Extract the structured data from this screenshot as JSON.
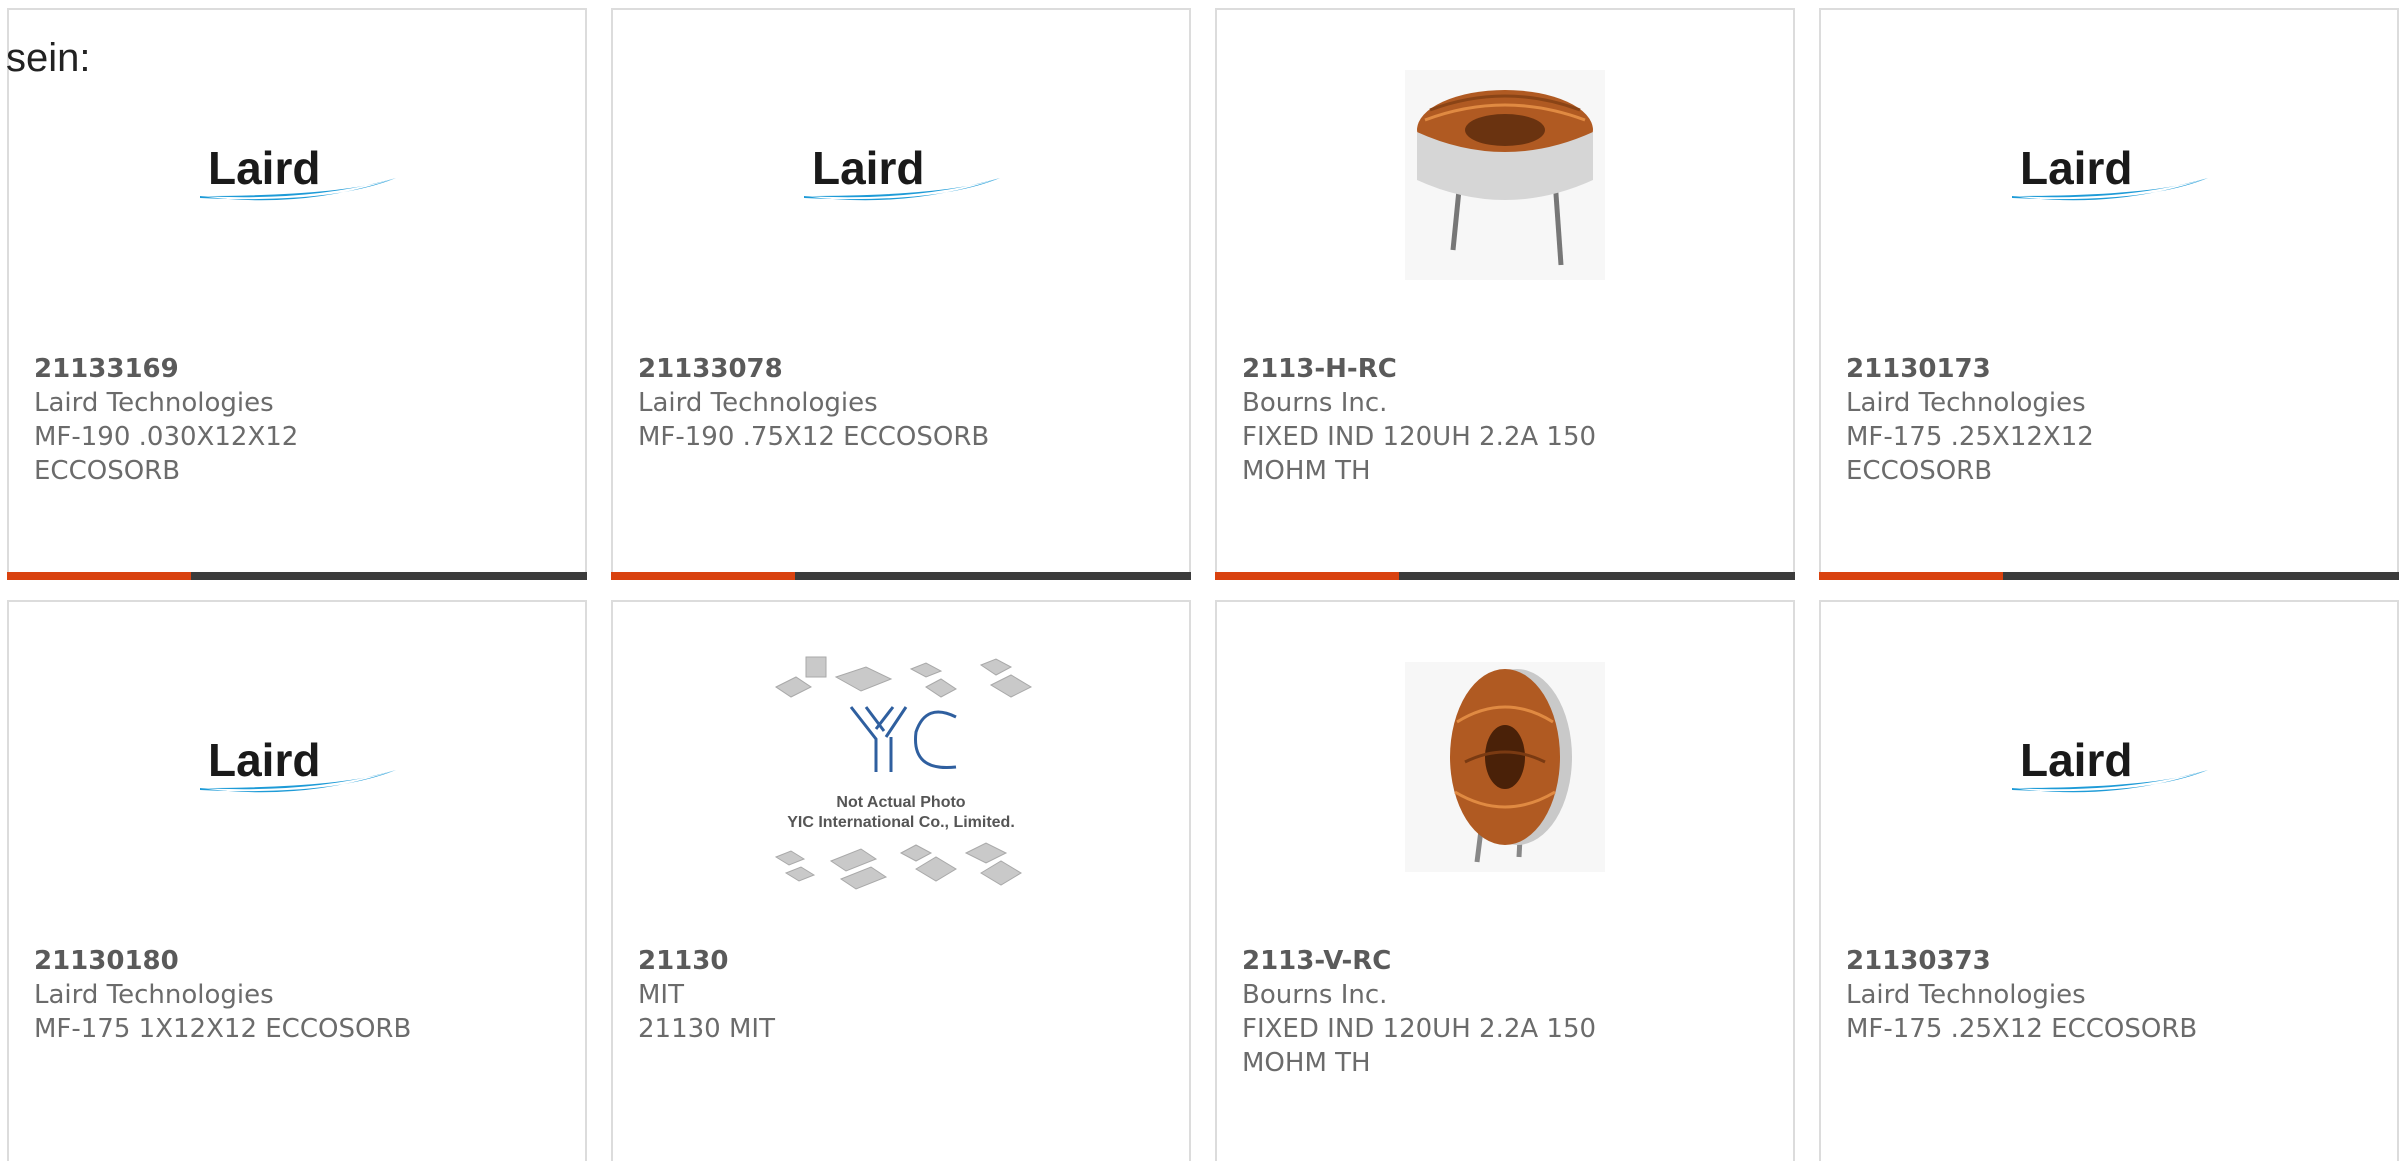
{
  "intro_text": "sein:",
  "colors": {
    "accent_bar": "#d9420f",
    "dark_bar": "#3b3b3b",
    "card_border": "#dcdcdc",
    "laird_text": "#1a1a1a",
    "laird_swoosh": "#1e9bd7"
  },
  "products": [
    {
      "part": "21133169",
      "manufacturer": "Laird Technologies",
      "description": "MF-190 .030X12X12 ECCOSORB",
      "image": "laird-logo"
    },
    {
      "part": "21133078",
      "manufacturer": "Laird Technologies",
      "description": "MF-190 .75X12 ECCOSORB",
      "image": "laird-logo"
    },
    {
      "part": "2113-H-RC",
      "manufacturer": "Bourns Inc.",
      "description": "FIXED IND 120UH 2.2A 150 MOHM TH",
      "image": "horizontal-toroid-inductor"
    },
    {
      "part": "21130173",
      "manufacturer": "Laird Technologies",
      "description": "MF-175 .25X12X12 ECCOSORB",
      "image": "laird-logo"
    },
    {
      "part": "21130180",
      "manufacturer": "Laird Technologies",
      "description": "MF-175 1X12X12 ECCOSORB",
      "image": "laird-logo"
    },
    {
      "part": "21130",
      "manufacturer": "MIT",
      "description": "21130 MIT",
      "image": "yic-placeholder",
      "placeholder_line1": "Not Actual Photo",
      "placeholder_line2": "YIC International Co., Limited."
    },
    {
      "part": "2113-V-RC",
      "manufacturer": "Bourns Inc.",
      "description": "FIXED IND 120UH 2.2A 150 MOHM TH",
      "image": "vertical-toroid-inductor"
    },
    {
      "part": "21130373",
      "manufacturer": "Laird Technologies",
      "description": "MF-175 .25X12 ECCOSORB",
      "image": "laird-logo"
    }
  ],
  "logo_text": "Laird"
}
